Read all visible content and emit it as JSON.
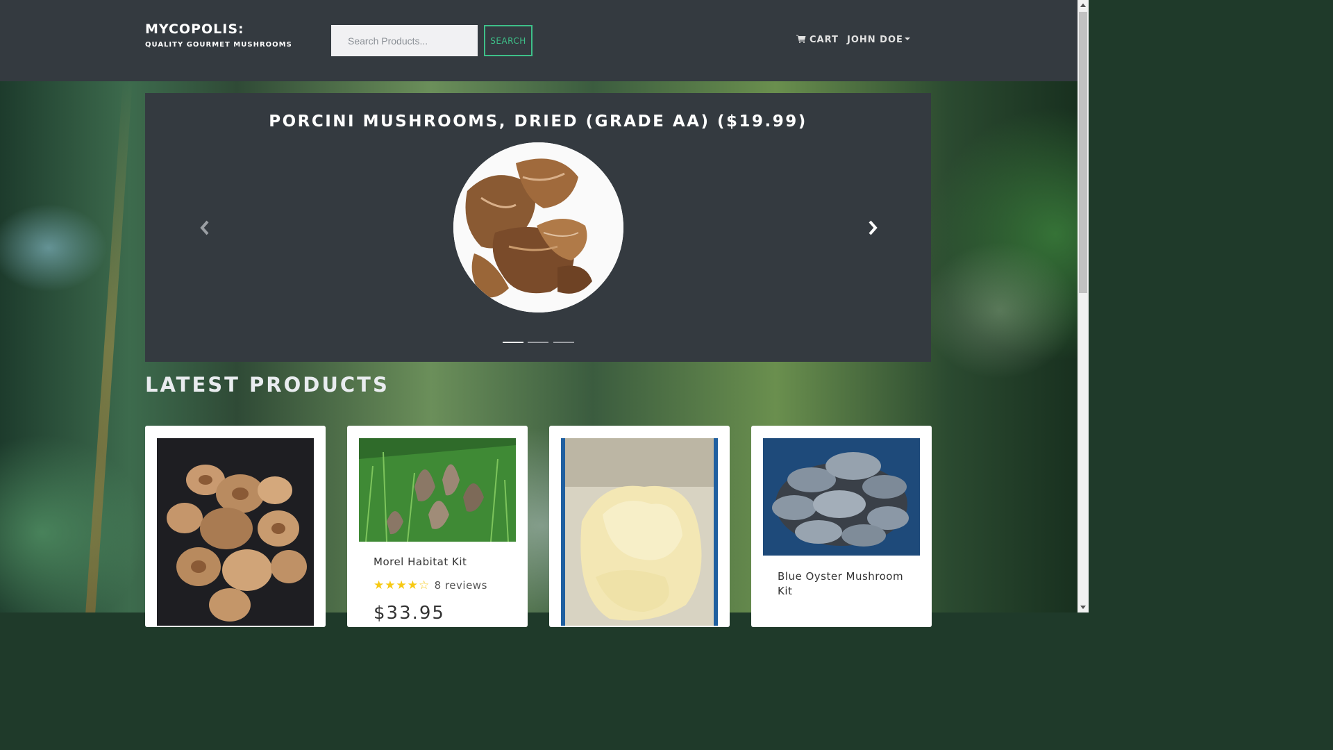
{
  "brand": {
    "title": "MYCOPOLIS:",
    "subtitle": "QUALITY GOURMET MUSHROOMS"
  },
  "search": {
    "placeholder": "Search Products...",
    "button_label": "SEARCH"
  },
  "nav": {
    "cart_label": "CART",
    "user_label": "JOHN DOE"
  },
  "carousel": {
    "caption": "PORCINI MUSHROOMS, DRIED (GRADE AA) ($19.99)",
    "slide_count": 3,
    "active_index": 0
  },
  "latest": {
    "title": "LATEST PRODUCTS",
    "products": [
      {
        "name": "",
        "image": "shiitake-cluster"
      },
      {
        "name": "Morel Habitat Kit",
        "rating": 4,
        "reviews": "8 reviews",
        "price": "$33.95",
        "image": "morels-in-grass"
      },
      {
        "name": "",
        "image": "lions-mane-grow-bag"
      },
      {
        "name": "Blue Oyster Mushroom Kit",
        "image": "blue-oyster-cluster"
      }
    ]
  },
  "colors": {
    "navbar": "#343a40",
    "accent": "#3ec089",
    "star": "#f7c913"
  }
}
